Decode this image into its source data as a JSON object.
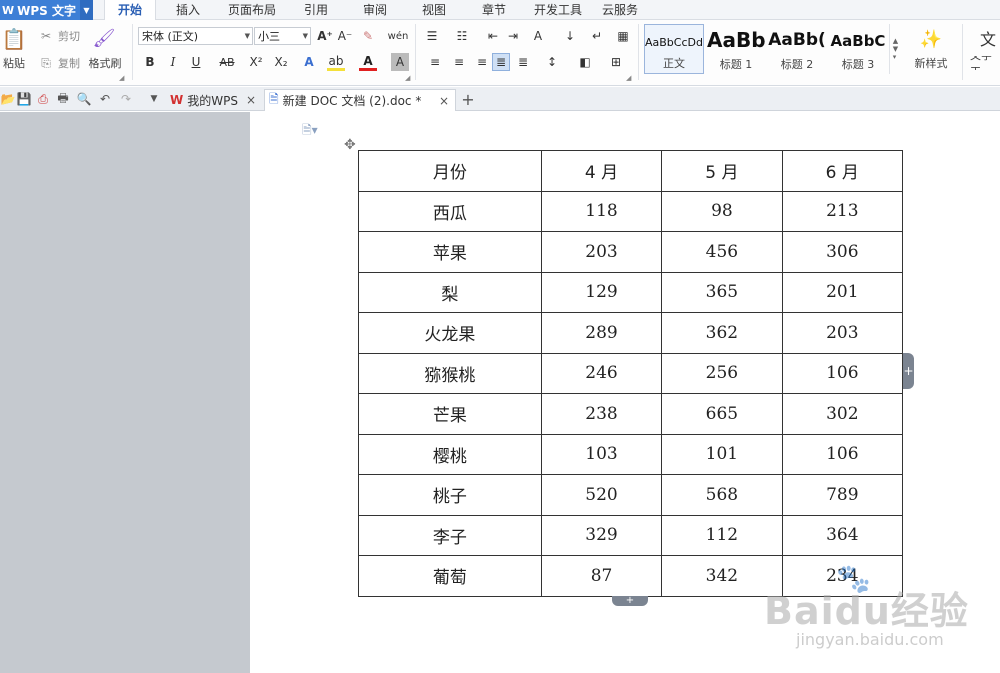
{
  "app": {
    "title": "WPS 文字",
    "logo": "W"
  },
  "menu_tabs": [
    "开始",
    "插入",
    "页面布局",
    "引用",
    "审阅",
    "视图",
    "章节",
    "开发工具",
    "云服务"
  ],
  "ribbon": {
    "paste": "粘贴",
    "cut": "剪切",
    "copy": "复制",
    "format_painter": "格式刷",
    "font_name": "宋体 (正文)",
    "font_size": "小三",
    "styles": [
      {
        "preview": "AaBbCcDd",
        "name": "正文"
      },
      {
        "preview": "AaBb",
        "name": "标题 1"
      },
      {
        "preview": "AaBb(",
        "name": "标题 2"
      },
      {
        "preview": "AaBbC",
        "name": "标题 3"
      }
    ],
    "new_style": "新样式",
    "text_tools": "文字工"
  },
  "doc_tabs": [
    {
      "label": "我的WPS",
      "close": "×"
    },
    {
      "label": "新建 DOC 文档 (2).doc *",
      "close": "×"
    }
  ],
  "add_tab": "+",
  "table": {
    "header": [
      "月份",
      "4 月",
      "5 月",
      "6 月"
    ],
    "rows": [
      [
        "西瓜",
        "118",
        "98",
        "213"
      ],
      [
        "苹果",
        "203",
        "456",
        "306"
      ],
      [
        "梨",
        "129",
        "365",
        "201"
      ],
      [
        "火龙果",
        "289",
        "362",
        "203"
      ],
      [
        "猕猴桃",
        "246",
        "256",
        "106"
      ],
      [
        "芒果",
        "238",
        "665",
        "302"
      ],
      [
        "樱桃",
        "103",
        "101",
        "106"
      ],
      [
        "桃子",
        "520",
        "568",
        "789"
      ],
      [
        "李子",
        "329",
        "112",
        "364"
      ],
      [
        "葡萄",
        "87",
        "342",
        "234"
      ]
    ]
  },
  "table_add_col": "+",
  "table_add_row": "+",
  "watermark": {
    "logo": "Baidu经验",
    "url": "jingyan.baidu.com"
  }
}
